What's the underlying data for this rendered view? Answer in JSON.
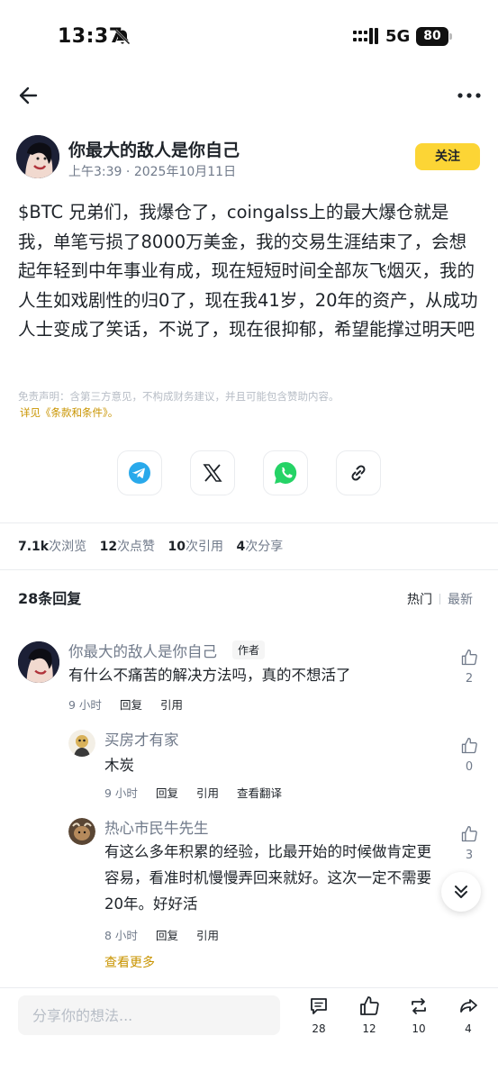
{
  "status_bar": {
    "time": "13:37",
    "network": "5G",
    "battery": "80"
  },
  "post": {
    "author_name": "你最大的敌人是你自己",
    "time": "上午3:39",
    "date": "2025年10月11日",
    "follow_label": "关注",
    "body": "$BTC 兄弟们，我爆仓了，coingalss上的最大爆仓就是我，单笔亏损了8000万美金，我的交易生涯结束了，会想起年轻到中年事业有成，现在短短时间全部灰飞烟灭，我的人生如戏剧性的归0了，现在我41岁，20年的资产，从成功人士变成了笑话，不说了，现在很抑郁，希望能撑过明天吧",
    "disclaimer": "免责声明：含第三方意见，不构成财务建议，并且可能包含赞助内容。",
    "terms_link": "详见《条款和条件》。"
  },
  "share_icons": [
    "telegram-icon",
    "x-icon",
    "whatsapp-icon",
    "copy-link-icon"
  ],
  "stats": {
    "views_value": "7.1k",
    "views_label": "次浏览",
    "likes_value": "12",
    "likes_label": "次点赞",
    "quotes_value": "10",
    "quotes_label": "次引用",
    "shares_value": "4",
    "shares_label": "次分享"
  },
  "replies": {
    "title": "28条回复",
    "sort_hot": "热门",
    "sort_new": "最新"
  },
  "comments": [
    {
      "name": "你最大的敌人是你自己",
      "tag": "作者",
      "text": "有什么不痛苦的解决方法吗，真的不想活了",
      "time": "9 小时",
      "reply_label": "回复",
      "quote_label": "引用",
      "likes": "2"
    },
    {
      "name": "买房才有家",
      "text": "木炭",
      "time": "9 小时",
      "reply_label": "回复",
      "quote_label": "引用",
      "translate_label": "查看翻译",
      "likes": "0"
    },
    {
      "name": "热心市民牛先生",
      "text": "有这么多年积累的经验，比最开始的时候做肯定更容易，看准时机慢慢弄回来就好。这次一定不需要20年。好好活",
      "time": "8 小时",
      "reply_label": "回复",
      "quote_label": "引用",
      "likes": "3"
    }
  ],
  "view_more": "查看更多",
  "bottom_bar": {
    "placeholder": "分享你的想法...",
    "comments_count": "28",
    "likes_count": "12",
    "reposts_count": "10",
    "shares_count": "4"
  },
  "colors": {
    "brand_yellow": "#fcd535",
    "link_gold": "#c99400",
    "text_primary": "#1e2329",
    "text_secondary": "#707a8a"
  }
}
